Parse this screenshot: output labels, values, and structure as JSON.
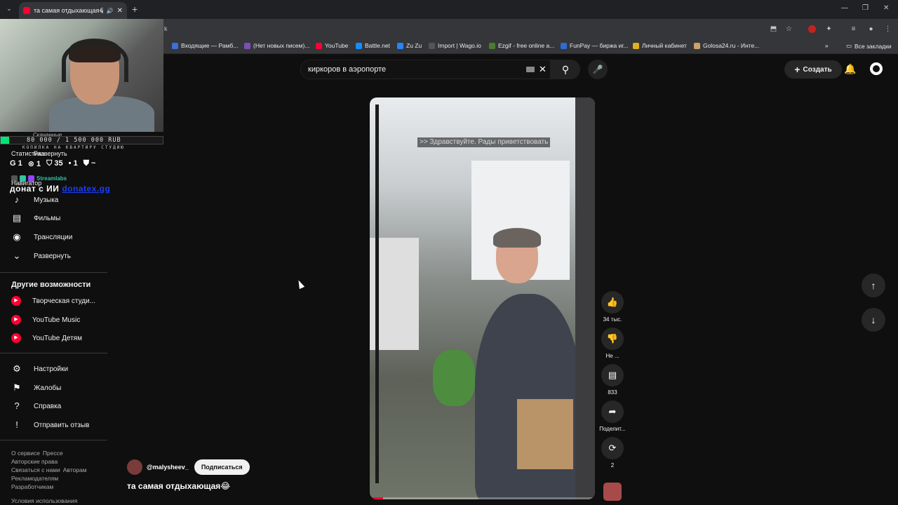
{
  "browser": {
    "tab_title": "та самая отдыхающая😂",
    "url_partial": "k",
    "bookmarks": [
      {
        "label": "Входящие — Рамб...",
        "color": "#3d6fd8"
      },
      {
        "label": "(Нет новых писем)...",
        "color": "#7b4fb5"
      },
      {
        "label": "YouTube",
        "color": "#ff0033"
      },
      {
        "label": "Battle.net",
        "color": "#148eff"
      },
      {
        "label": "Zu Zu",
        "color": "#2787f5"
      },
      {
        "label": "Import | Wago.io",
        "color": "#222222"
      },
      {
        "label": "Ezgif - free online a...",
        "color": "#4a7c2e"
      },
      {
        "label": "FunPay — биржа иг...",
        "color": "#2b6cd6"
      },
      {
        "label": "Личный кабинет",
        "color": "#e0b020"
      },
      {
        "label": "Golosa24.ru - Инте...",
        "color": "#c9a36b"
      }
    ],
    "all_bookmarks_label": "Все закладки"
  },
  "youtube": {
    "search_query": "киркоров в аэропорте",
    "create_label": "Создать",
    "sidebar": {
      "items_top": [
        {
          "label": "Музыка",
          "icon": "music-note-icon"
        },
        {
          "label": "Фильмы",
          "icon": "film-icon"
        },
        {
          "label": "Трансляции",
          "icon": "live-icon"
        },
        {
          "label": "Развернуть",
          "icon": "chevron-down-icon"
        }
      ],
      "other_heading": "Другие возможности",
      "other_items": [
        {
          "label": "Творческая студи...",
          "icon": "youtube-studio-icon"
        },
        {
          "label": "YouTube Music",
          "icon": "youtube-music-icon"
        },
        {
          "label": "YouTube Детям",
          "icon": "youtube-kids-icon"
        }
      ],
      "settings_items": [
        {
          "label": "Настройки",
          "icon": "gear-icon"
        },
        {
          "label": "Жалобы",
          "icon": "flag-icon"
        },
        {
          "label": "Справка",
          "icon": "help-icon"
        },
        {
          "label": "Отправить отзыв",
          "icon": "feedback-icon"
        }
      ],
      "footer_line1": [
        "О сервисе",
        "Прессе"
      ],
      "footer_line2": [
        "Авторские права"
      ],
      "footer_line3": [
        "Связаться с нами",
        "Авторам"
      ],
      "footer_line4": [
        "Рекламодателям"
      ],
      "footer_line5": [
        "Разработчикам"
      ],
      "footer_line6": [
        "Условия использования"
      ]
    },
    "video": {
      "subtitle": ">> Здравствуйте. Рады приветствовать",
      "progress": 0.06,
      "likes": "34 тыс.",
      "dislike_label": "Не ...",
      "comments": "833",
      "share_label": "Поделит...",
      "remix_count": "2",
      "channel": "@malysheev_",
      "subscribe_label": "Подписаться",
      "title": "та самая отдыхающая😂"
    }
  },
  "stream_overlay": {
    "goal_text": "80 000 / 1 500 000 RUB",
    "goal_progress": 0.053,
    "goal_subtitle": "КОПИЛКА НА КВАРТИРУ СТУДИЮ",
    "ghost_text_1": "Скачанные",
    "ghost_text_2": "Статистика",
    "ghost_text_3": "Развернуть",
    "ghost_text_4": "Навигатор",
    "stats": [
      "G 1",
      "⊗ 1",
      "⛉ 35",
      "• 1",
      "⛊ ~"
    ],
    "streamlabs_label": "Streamlabs",
    "donat_text": "донат с ИИ",
    "donat_link": "donatex.gg"
  }
}
